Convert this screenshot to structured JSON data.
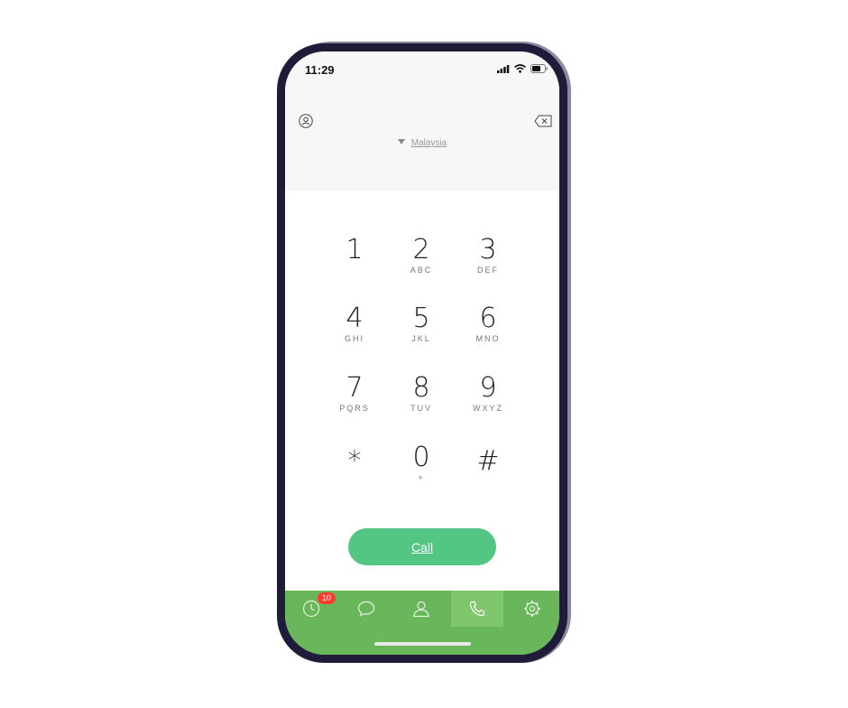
{
  "status_bar": {
    "time": "11:29"
  },
  "header": {
    "country": "Malaysia"
  },
  "keypad": [
    {
      "digit": "1",
      "letters": ""
    },
    {
      "digit": "2",
      "letters": "ABC"
    },
    {
      "digit": "3",
      "letters": "DEF"
    },
    {
      "digit": "4",
      "letters": "GHI"
    },
    {
      "digit": "5",
      "letters": "JKL"
    },
    {
      "digit": "6",
      "letters": "MNO"
    },
    {
      "digit": "7",
      "letters": "PQRS"
    },
    {
      "digit": "8",
      "letters": "TUV"
    },
    {
      "digit": "9",
      "letters": "WXYZ"
    },
    {
      "digit": "*",
      "letters": ""
    },
    {
      "digit": "0",
      "letters": "+"
    },
    {
      "digit": "#",
      "letters": ""
    }
  ],
  "call_button": {
    "label": "Call"
  },
  "tabs": [
    {
      "icon": "clock-icon",
      "badge": "10",
      "active": false
    },
    {
      "icon": "chat-bubble-icon",
      "active": false
    },
    {
      "icon": "person-icon",
      "active": false
    },
    {
      "icon": "phone-icon",
      "active": true
    },
    {
      "icon": "gear-icon",
      "active": false
    }
  ],
  "colors": {
    "call_button": "#53c683",
    "tab_bar": "#6ab65a",
    "tab_active": "#7fc66c",
    "badge": "#ff3b30"
  }
}
